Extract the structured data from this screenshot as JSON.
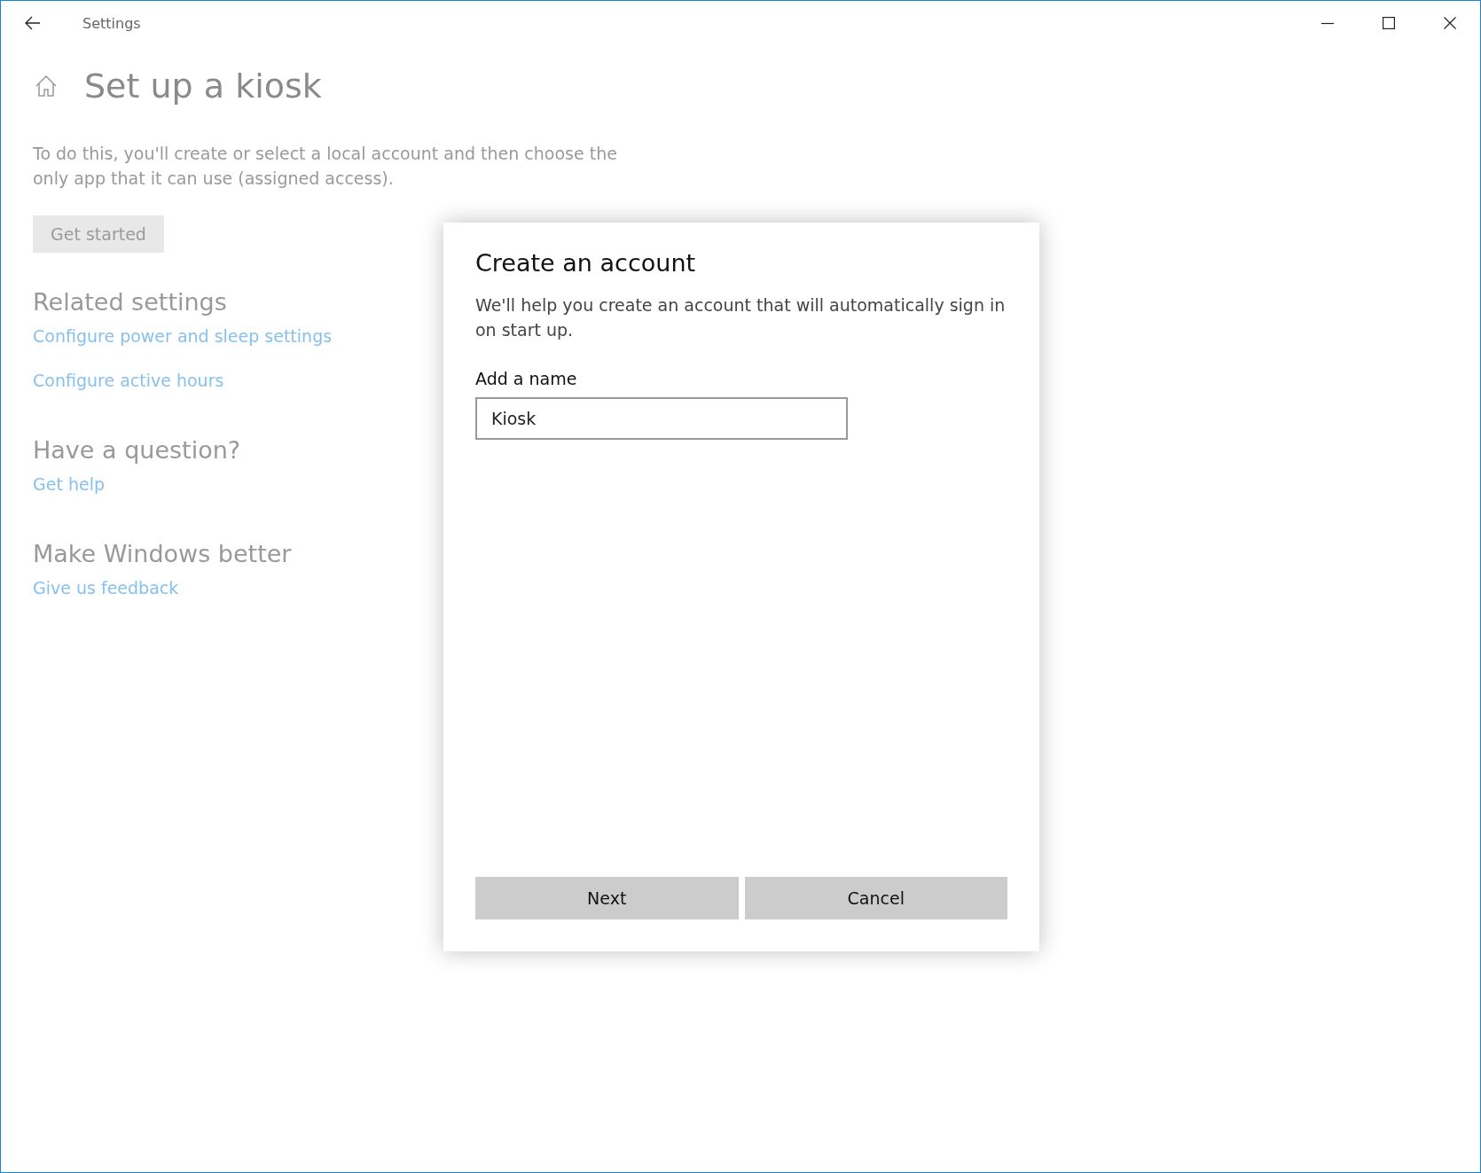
{
  "window": {
    "title": "Settings"
  },
  "page": {
    "title": "Set up a kiosk",
    "description": "To do this, you'll create or select a local account and then choose the only app that it can use (assigned access).",
    "button": "Get started"
  },
  "sections": [
    {
      "heading": "Related settings",
      "links": [
        "Configure power and sleep settings",
        "Configure active hours"
      ]
    },
    {
      "heading": "Have a question?",
      "links": [
        "Get help"
      ]
    },
    {
      "heading": "Make Windows better",
      "links": [
        "Give us feedback"
      ]
    }
  ],
  "dialog": {
    "title": "Create an account",
    "text": "We'll help you create an account that will automatically sign in on start up.",
    "field_label": "Add a name",
    "field_value": "Kiosk",
    "buttons": [
      "Next",
      "Cancel"
    ]
  }
}
